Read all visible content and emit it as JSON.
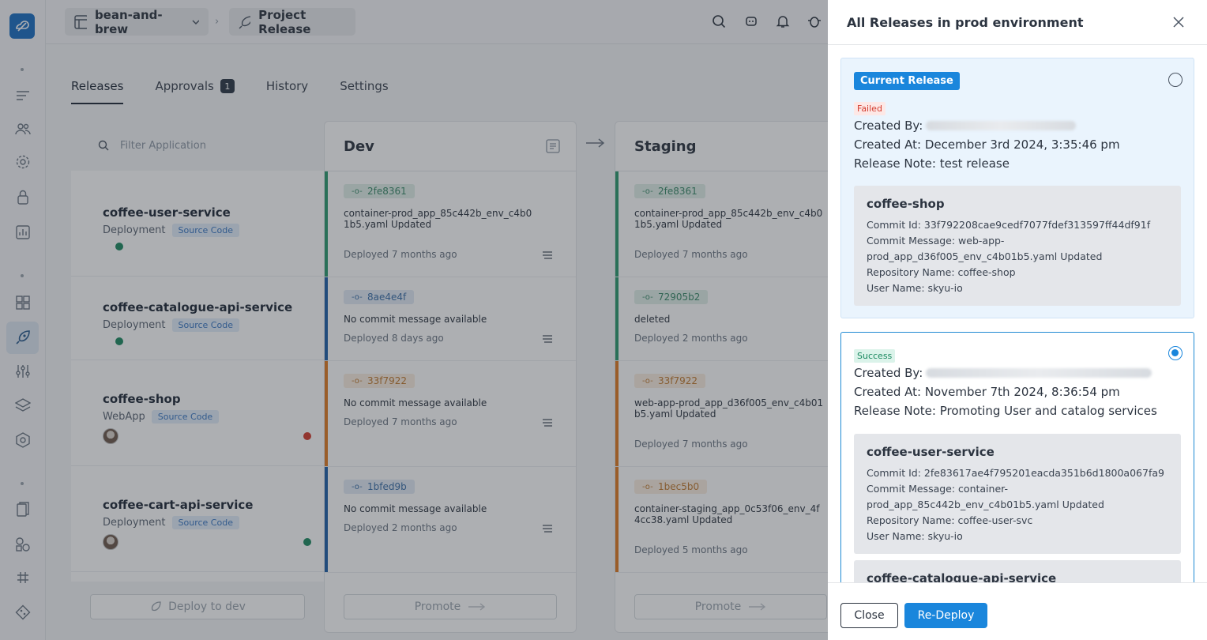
{
  "topbar": {
    "workspace": "bean-and-brew",
    "project": "Project Release"
  },
  "tabs": [
    {
      "label": "Releases"
    },
    {
      "label": "Approvals",
      "badge": "1"
    },
    {
      "label": "History"
    },
    {
      "label": "Settings"
    }
  ],
  "filter": {
    "placeholder": "Filter Application"
  },
  "apps": [
    {
      "name": "coffee-user-service",
      "type": "Deployment",
      "source": "Source Code",
      "status_color": "#1d8a61"
    },
    {
      "name": "coffee-catalogue-api-service",
      "type": "Deployment",
      "source": "Source Code",
      "status_color": "#1d8a61"
    },
    {
      "name": "coffee-shop",
      "type": "WebApp",
      "source": "Source Code",
      "status_color": "#d33c2e"
    },
    {
      "name": "coffee-cart-api-service",
      "type": "Deployment",
      "source": "Source Code",
      "status_color": "#1d8a61"
    }
  ],
  "envs": {
    "dev": {
      "title": "Dev",
      "cells": [
        {
          "hash": "2fe8361",
          "message": "container-prod_app_85c442b_env_c4b01b5.yaml Updated",
          "deployed": "Deployed 7 months ago"
        },
        {
          "hash": "8ae4e4f",
          "message": "No commit message available",
          "deployed": "Deployed 8 days ago"
        },
        {
          "hash": "33f7922",
          "message": "No commit message available",
          "deployed": "Deployed 7 months ago"
        },
        {
          "hash": "1bfed9b",
          "message": "No commit message available",
          "deployed": "Deployed 2 months ago"
        }
      ],
      "promote": "Promote"
    },
    "staging": {
      "title": "Staging",
      "cells": [
        {
          "hash": "2fe8361",
          "message": "container-prod_app_85c442b_env_c4b01b5.yaml Updated",
          "deployed": "Deployed 7 months ago"
        },
        {
          "hash": "72905b2",
          "message": "deleted",
          "deployed": "Deployed 2 months ago"
        },
        {
          "hash": "33f7922",
          "message": "web-app-prod_app_d36f005_env_c4b01b5.yaml Updated",
          "deployed": "Deployed 7 months ago"
        },
        {
          "hash": "1bec5b0",
          "message": "container-staging_app_0c53f06_env_4f4cc38.yaml Updated",
          "deployed": "Deployed 5 months ago"
        }
      ],
      "promote": "Promote"
    }
  },
  "deploy_button": "Deploy to dev",
  "drawer": {
    "title": "All Releases in prod environment",
    "releases": [
      {
        "badge": "Current Release",
        "status": "Failed",
        "created_by_label": "Created By:",
        "created_at": "Created At: December 3rd 2024, 3:35:46 pm",
        "note": "Release Note: test release",
        "apps": [
          {
            "name": "coffee-shop",
            "commit_id": "Commit Id: 33f792208cae9cedf7077fdef313597ff44df91f",
            "commit_message": "Commit Message: web-app-prod_app_d36f005_env_c4b01b5.yaml Updated",
            "repo": "Repository Name: coffee-shop",
            "user": "User Name: skyu-io"
          }
        ]
      },
      {
        "status": "Success",
        "created_by_label": "Created By:",
        "created_at": "Created At: November 7th 2024, 8:36:54 pm",
        "note": "Release Note: Promoting User and catalog services",
        "apps": [
          {
            "name": "coffee-user-service",
            "commit_id": "Commit Id: 2fe83617ae4f795201eacda351b6d1800a067fa9",
            "commit_message": "Commit Message: container-prod_app_85c442b_env_c4b01b5.yaml Updated",
            "repo": "Repository Name: coffee-user-svc",
            "user": "User Name: skyu-io"
          },
          {
            "name": "coffee-catalogue-api-service"
          }
        ]
      }
    ],
    "close_button": "Close",
    "redeploy_button": "Re-Deploy"
  }
}
